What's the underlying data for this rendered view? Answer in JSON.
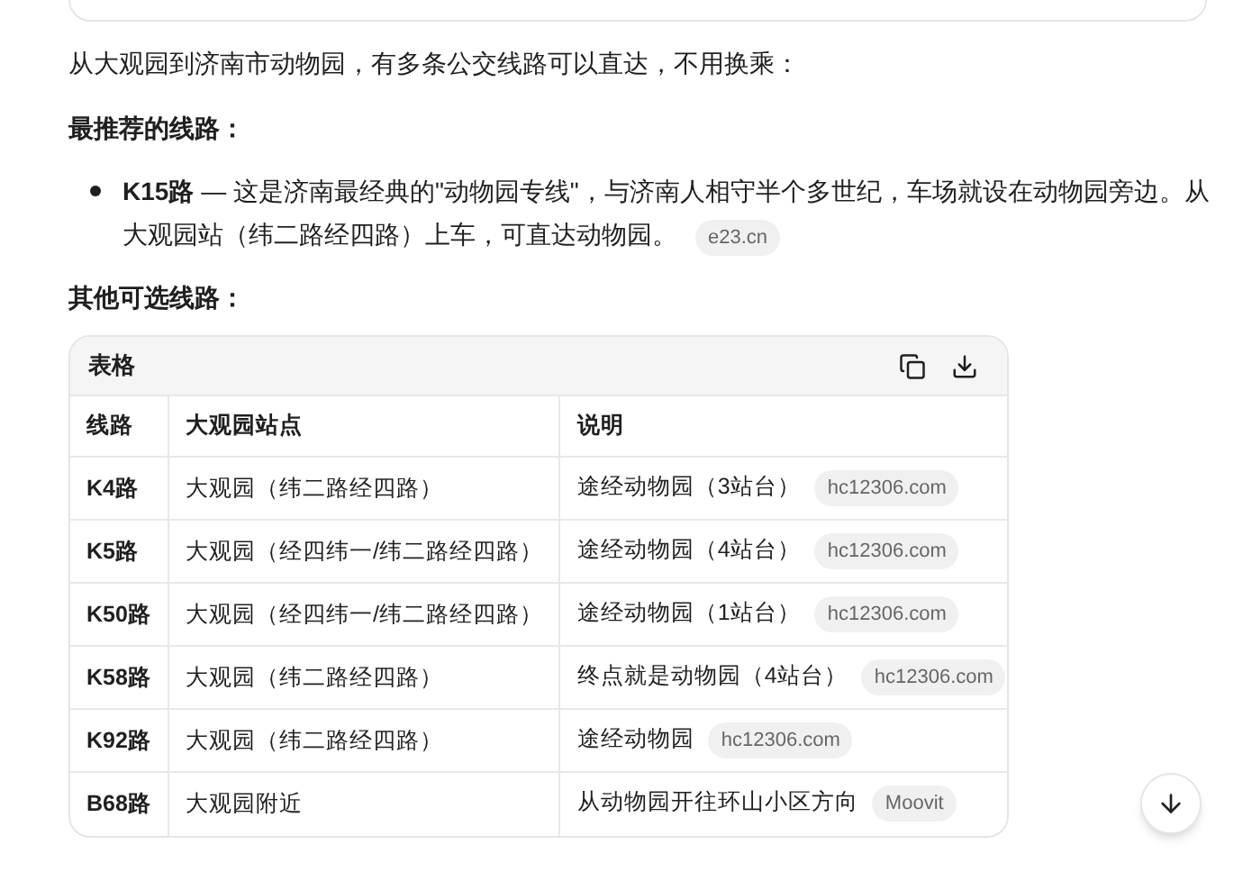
{
  "intro": "从大观园到济南市动物园，有多条公交线路可以直达，不用换乘：",
  "recommended": {
    "heading": "最推荐的线路：",
    "items": [
      {
        "text": "**K15路** — 这是济南最经典的\"动物园专线\"，与济南人相守半个多世纪，车场就设在动物园旁边。从大观园站（纬二路经四路）上车，可直达动物园。",
        "source": "e23.cn"
      }
    ]
  },
  "others_heading": "其他可选线路：",
  "table": {
    "title": "表格",
    "columns": [
      "线路",
      "大观园站点",
      "说明"
    ],
    "rows": [
      {
        "route": "K4路",
        "stop": "大观园（纬二路经四路）",
        "note": "途经动物园（3站台）",
        "source": "hc12306.com"
      },
      {
        "route": "K5路",
        "stop": "大观园（经四纬一/纬二路经四路）",
        "note": "途经动物园（4站台）",
        "source": "hc12306.com"
      },
      {
        "route": "K50路",
        "stop": "大观园（经四纬一/纬二路经四路）",
        "note": "途经动物园（1站台）",
        "source": "hc12306.com"
      },
      {
        "route": "K58路",
        "stop": "大观园（纬二路经四路）",
        "note": "终点就是动物园（4站台）",
        "source": "hc12306.com"
      },
      {
        "route": "K92路",
        "stop": "大观园（纬二路经四路）",
        "note": "途经动物园",
        "source": "hc12306.com"
      },
      {
        "route": "B68路",
        "stop": "大观园附近",
        "note": "从动物园开往环山小区方向",
        "source": "Moovit"
      }
    ]
  }
}
